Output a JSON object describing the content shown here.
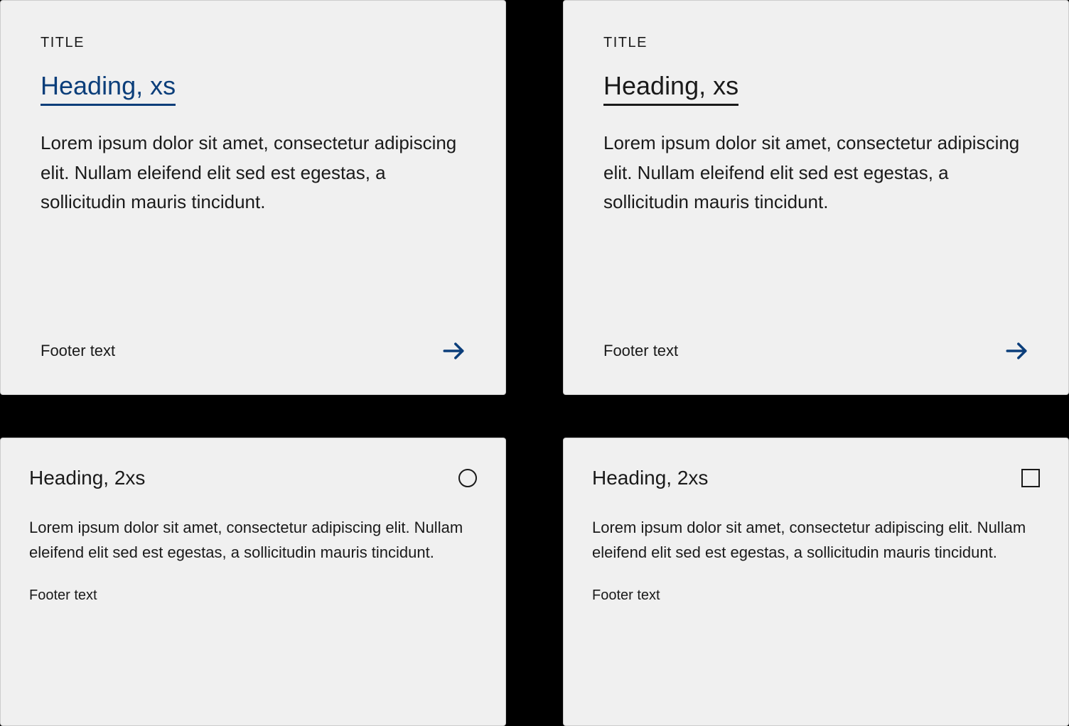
{
  "colors": {
    "accent_blue": "#0b3e7a",
    "text_black": "#1a1a1a",
    "card_bg": "#f0f0f0"
  },
  "cards": [
    {
      "overline": "TITLE",
      "heading": "Heading, xs",
      "heading_color": "blue",
      "body": "Lorem ipsum dolor sit amet, consectetur adipiscing elit. Nullam eleifend elit sed est egestas, a sollicitudin mauris tincidunt.",
      "footer": "Footer text",
      "has_arrow": true
    },
    {
      "overline": "TITLE",
      "heading": "Heading, xs",
      "heading_color": "black",
      "body": "Lorem ipsum dolor sit amet, consectetur adipiscing elit. Nullam eleifend elit sed est egestas, a sollicitudin mauris tincidunt.",
      "footer": "Footer text",
      "has_arrow": true
    },
    {
      "heading": "Heading, 2xs",
      "control": "radio",
      "body": "Lorem ipsum dolor sit amet, consectetur adipiscing elit. Nullam eleifend elit sed est egestas, a sollicitudin mauris tincidunt.",
      "footer": "Footer text"
    },
    {
      "heading": "Heading, 2xs",
      "control": "checkbox",
      "body": "Lorem ipsum dolor sit amet, consectetur adipiscing elit. Nullam eleifend elit sed est egestas, a sollicitudin mauris tincidunt.",
      "footer": "Footer text"
    }
  ]
}
